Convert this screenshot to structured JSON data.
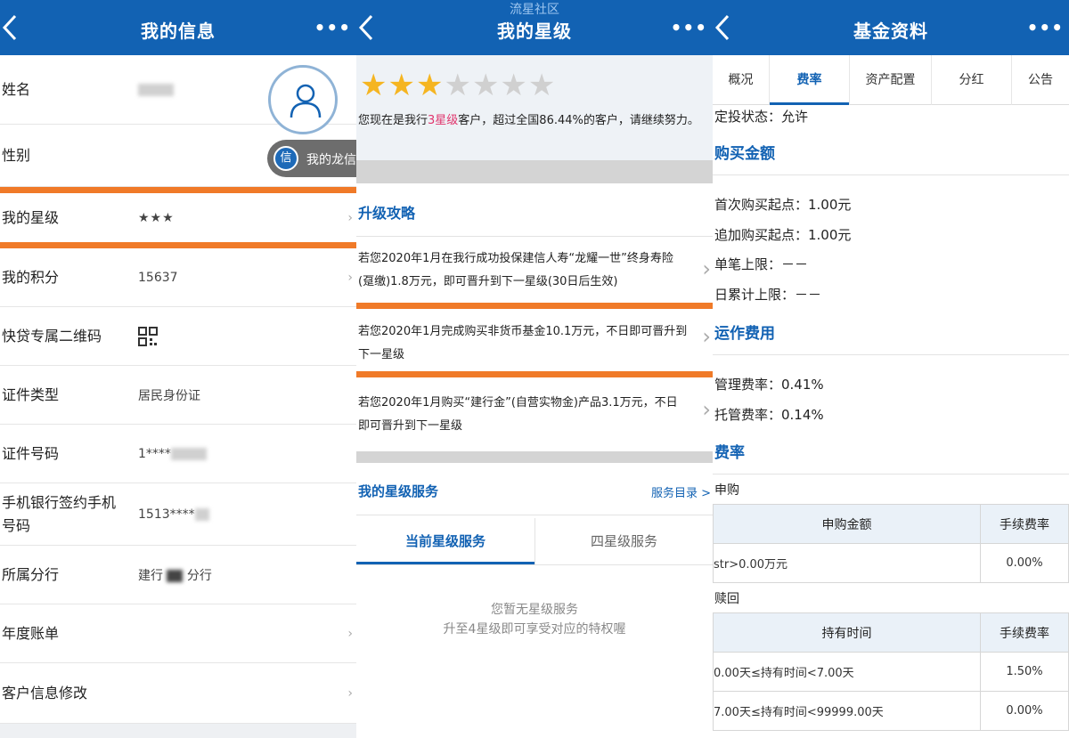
{
  "watermark": "流星社区",
  "panel1": {
    "title": "我的信息",
    "more": "•••",
    "avatar_badge": "我的龙信",
    "avatar_badge_icon": "信",
    "rows": [
      {
        "label": "姓名",
        "value": "陈**"
      },
      {
        "label": "性别",
        "value": ""
      },
      {
        "label": "我的星级",
        "value": "★★★"
      },
      {
        "label": "我的积分",
        "value": "15637"
      },
      {
        "label": "快贷专属二维码",
        "value": ""
      },
      {
        "label": "证件类型",
        "value": "居民身份证"
      },
      {
        "label": "证件号码",
        "value": "1****"
      },
      {
        "label": "手机银行签约手机号码",
        "value": "1513****"
      },
      {
        "label": "所属分行",
        "value": "建行",
        "value_suffix": "分行"
      },
      {
        "label": "年度账单",
        "value": ""
      },
      {
        "label": "客户信息修改",
        "value": ""
      }
    ],
    "colors": {
      "header": "#1262b3",
      "accent_bar": "#f07a28",
      "star": "#f5b521"
    }
  },
  "panel2": {
    "title": "我的星级",
    "more": "•••",
    "star_rating": 3,
    "star_total": 7,
    "status_prefix": "您现在是我行",
    "status_highlight": "3星级",
    "status_suffix": "客户，超过全国86.44%的客户，请继续努力。",
    "upgrade_title": "升级攻略",
    "tips": [
      "若您2020年1月在我行成功投保建信人寿“龙耀一世”终身寿险(趸缴)1.8万元，即可晋升到下一星级(30日后生效)",
      "若您2020年1月完成购买非货币基金10.1万元，不日即可晋升到下一星级",
      "若您2020年1月购买“建行金”(自营实物金)产品3.1万元，不日即可晋升到下一星级"
    ],
    "service_title": "我的星级服务",
    "service_link": "服务目录 >",
    "tabs": [
      "当前星级服务",
      "四星级服务"
    ],
    "empty_line1": "您暂无星级服务",
    "empty_line2": "升至4星级即可享受对应的特权喔"
  },
  "panel3": {
    "title": "基金资料",
    "more": "•••",
    "tabs": [
      "概况",
      "费率",
      "资产配置",
      "分红",
      "公告"
    ],
    "active_tab": 1,
    "dingtou": "定投状态：允许",
    "buy_title": "购买金额",
    "buy_lines": [
      "首次购买起点：1.00元",
      "追加购买起点：1.00元",
      "单笔上限：－－",
      "日累计上限：－－"
    ],
    "ops_title": "运作费用",
    "ops_lines": [
      "管理费率：0.41%",
      "托管费率：0.14%"
    ],
    "fee_title": "费率",
    "subscribe_label": "申购",
    "subscribe_headers": [
      "申购金额",
      "手续费率"
    ],
    "subscribe_rows": [
      [
        "str>0.00万元",
        "0.00%"
      ]
    ],
    "redeem_label": "赎回",
    "redeem_headers": [
      "持有时间",
      "手续费率"
    ],
    "redeem_rows": [
      [
        "0.00天≤持有时间<7.00天",
        "1.50%"
      ],
      [
        "7.00天≤持有时间<99999.00天",
        "0.00%"
      ]
    ]
  }
}
